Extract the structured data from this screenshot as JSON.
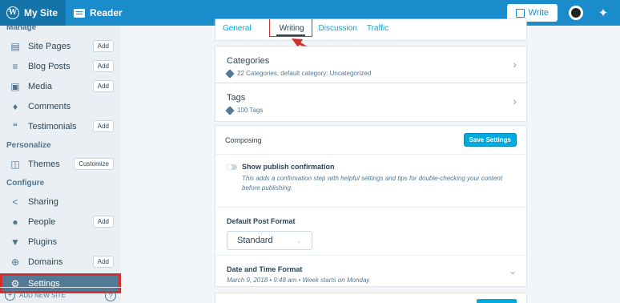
{
  "topbar": {
    "my_site": "My Site",
    "reader": "Reader",
    "write": "Write"
  },
  "sidebar": {
    "heading_manage": "Manage",
    "heading_personalize": "Personalize",
    "heading_configure": "Configure",
    "items": [
      {
        "label": "Site Pages",
        "icon": "page-icon",
        "btn": "Add"
      },
      {
        "label": "Blog Posts",
        "icon": "posts-icon",
        "btn": "Add"
      },
      {
        "label": "Media",
        "icon": "image-icon",
        "btn": "Add"
      },
      {
        "label": "Comments",
        "icon": "comments-icon",
        "btn": ""
      },
      {
        "label": "Testimonials",
        "icon": "quote-icon",
        "btn": "Add"
      },
      {
        "label": "Themes",
        "icon": "themes-icon",
        "btn": "Customize"
      },
      {
        "label": "Sharing",
        "icon": "share-icon",
        "btn": ""
      },
      {
        "label": "People",
        "icon": "person-icon",
        "btn": "Add"
      },
      {
        "label": "Plugins",
        "icon": "plugin-icon",
        "btn": ""
      },
      {
        "label": "Domains",
        "icon": "globe-icon",
        "btn": "Add"
      },
      {
        "label": "Settings",
        "icon": "cog-icon",
        "btn": ""
      }
    ],
    "footer": {
      "add_new_site": "ADD NEW SITE",
      "help": "?"
    }
  },
  "tabs": [
    {
      "label": "General"
    },
    {
      "label": "Writing"
    },
    {
      "label": "Discussion"
    },
    {
      "label": "Traffic"
    }
  ],
  "categories": {
    "title": "Categories",
    "sub": "22 Categories, default category: Uncategorized"
  },
  "tags": {
    "title": "Tags",
    "sub": "100 Tags"
  },
  "composing": {
    "title": "Composing",
    "save": "Save Settings",
    "option_title": "Show publish confirmation",
    "option_desc": "This adds a confirmation step with helpful settings and tips for double-checking your content before publishing.",
    "format_label": "Default Post Format",
    "format_value": "Standard",
    "date_label": "Date and Time Format",
    "date_value": "March 9, 2018 • 9:48 am • Week starts on Monday"
  },
  "colors": {
    "accent": "#00aadc",
    "topbar": "#1a8ccc",
    "highlight": "#d42f2f"
  }
}
